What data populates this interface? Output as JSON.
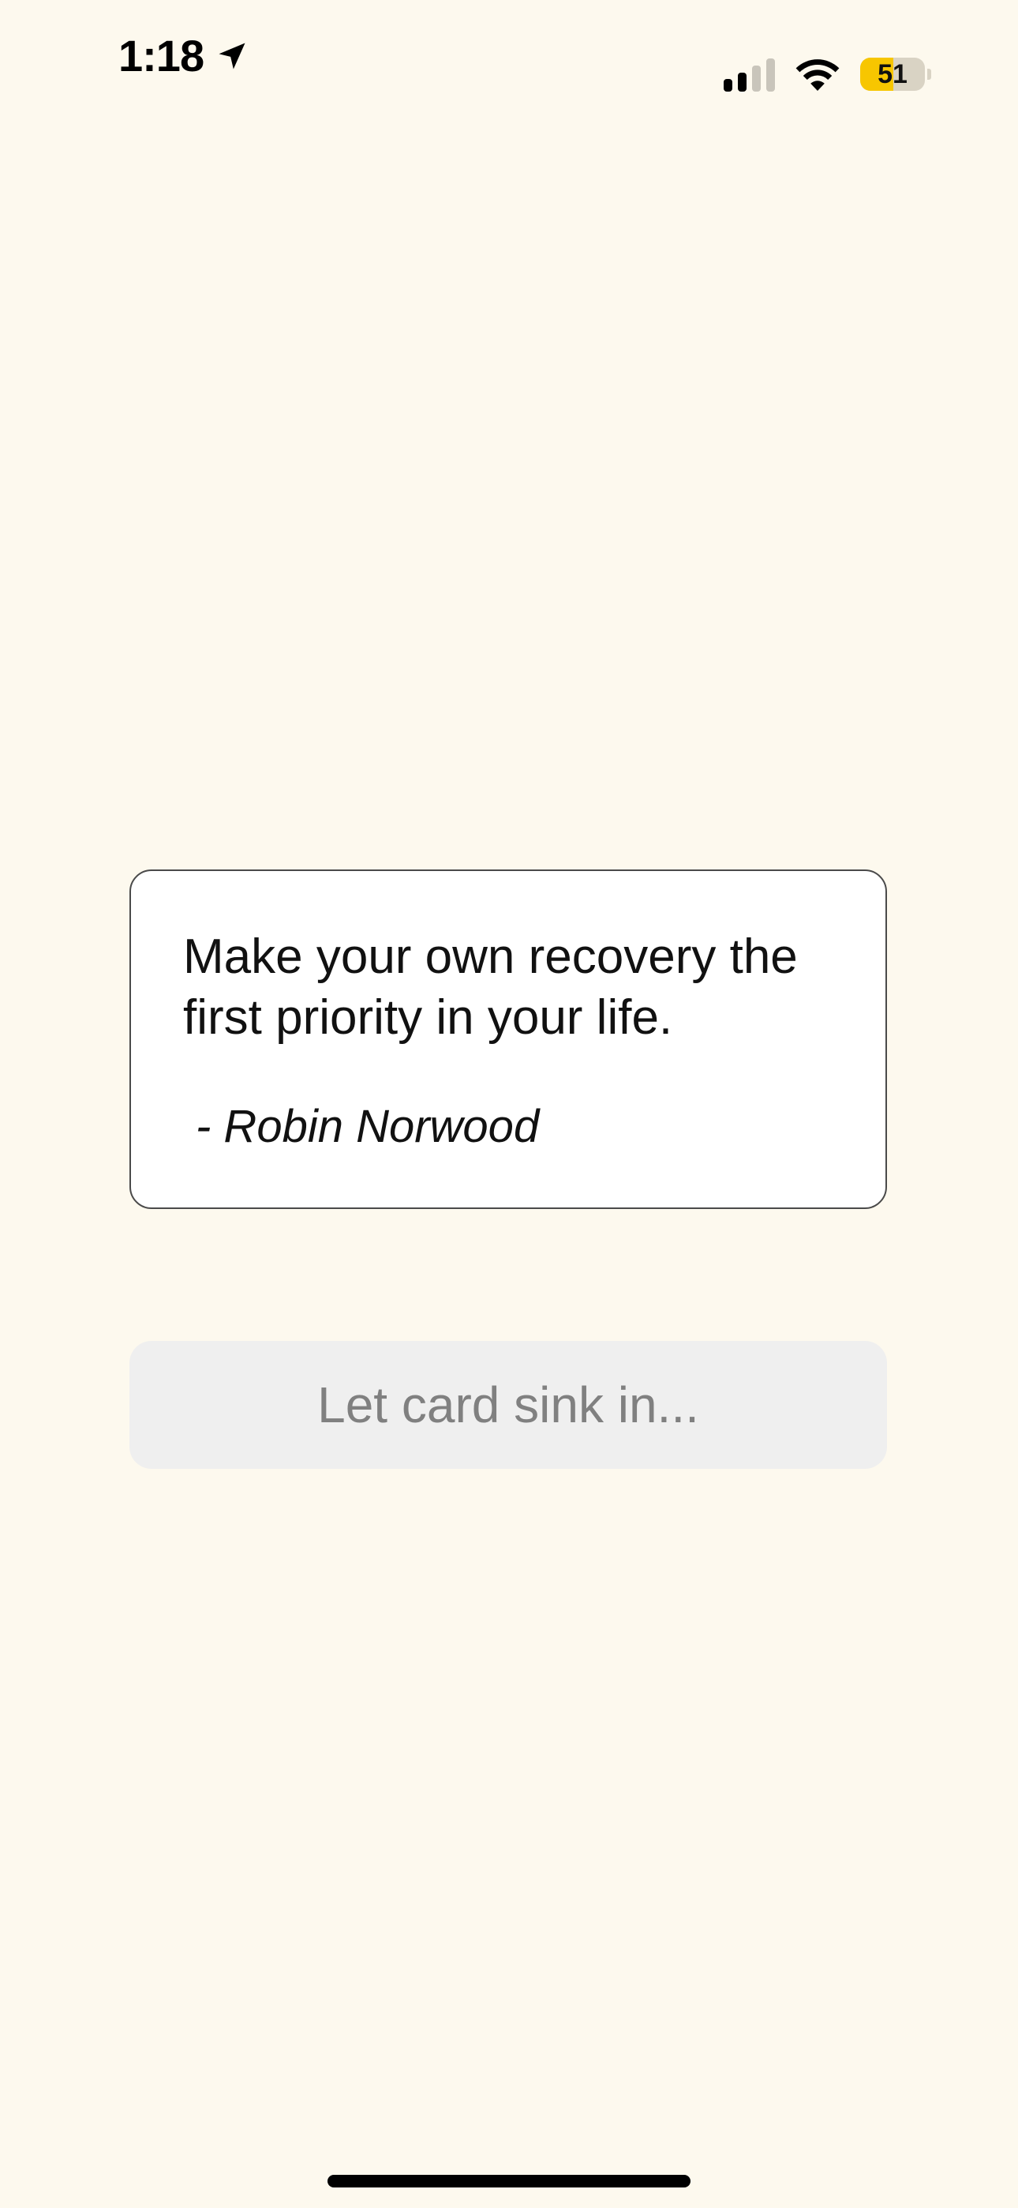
{
  "status_bar": {
    "time": "1:18",
    "location_icon": "location-arrow-icon",
    "signal_icon": "cellular-signal-icon",
    "signal_bars_active": 2,
    "signal_bars_total": 4,
    "wifi_icon": "wifi-icon",
    "battery_percent": "51",
    "battery_level": 0.51,
    "battery_color": "#f7c600"
  },
  "quote": {
    "text": "Make your own recovery the first priority in your life.",
    "author": "- Robin Norwood"
  },
  "action": {
    "label": "Let card sink in..."
  },
  "colors": {
    "background": "#fdf9ee",
    "card": "#ffffff",
    "button_bg": "#efefef",
    "button_text": "#808080"
  }
}
